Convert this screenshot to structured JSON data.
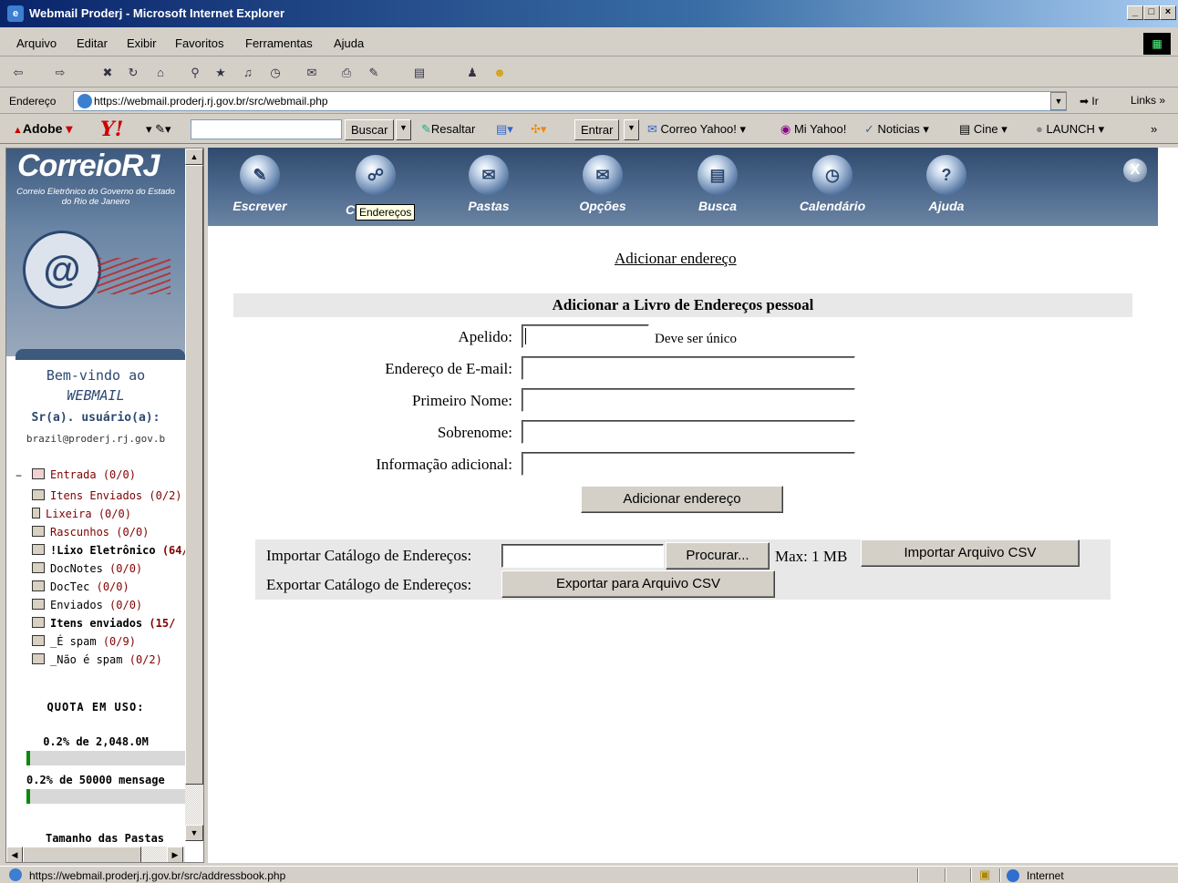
{
  "window": {
    "title": "Webmail Proderj - Microsoft Internet Explorer"
  },
  "menu": [
    "Arquivo",
    "Editar",
    "Exibir",
    "Favoritos",
    "Ferramentas",
    "Ajuda"
  ],
  "address": {
    "label": "Endereço",
    "url": "https://webmail.proderj.rj.gov.br/src/webmail.php",
    "go": "Ir",
    "links": "Links"
  },
  "yahoo_toolbar": {
    "adobe": "Adobe",
    "yahoo": "Y!",
    "search_button": "Buscar",
    "highlight": "Resaltar",
    "enter": "Entrar",
    "mail": "Correo Yahoo!",
    "my_yahoo": "Mi Yahoo!",
    "news": "Noticias",
    "cinema": "Cine",
    "launch": "LAUNCH"
  },
  "sidebar": {
    "logo": "CorreioRJ",
    "subtitle": "Correio Eletrônico do Governo do Estado do Rio de Janeiro",
    "welcome_line1": "Bem-vindo ao",
    "welcome_line2": "WEBMAIL",
    "user_label": "Sr(a). usuário(a):",
    "user_email": "brazil@proderj.rj.gov.b",
    "folders": [
      {
        "name": "Entrada",
        "count": "(0/0)"
      },
      {
        "name": "Itens Enviados",
        "count": "(0/2)"
      },
      {
        "name": "Lixeira",
        "count": "(0/0)"
      },
      {
        "name": "Rascunhos",
        "count": "(0/0)"
      },
      {
        "name": "!Lixo Eletrônico",
        "count": "(64/"
      },
      {
        "name": "DocNotes",
        "count": "(0/0)"
      },
      {
        "name": "DocTec",
        "count": "(0/0)"
      },
      {
        "name": "Enviados",
        "count": "(0/0)"
      },
      {
        "name": "Itens enviados",
        "count": "(15/"
      },
      {
        "name": "_É spam",
        "count": "(0/9)"
      },
      {
        "name": "_Não é spam",
        "count": "(0/2)"
      }
    ],
    "quota_title": "QUOTA EM USO:",
    "quota_size": "0.2% de 2,048.0M",
    "quota_size_fraction": 0.02,
    "quota_msgs": "0.2% de 50000 mensage",
    "quota_msgs_fraction": 0.02,
    "folder_sizes": "Tamanho das Pastas"
  },
  "nav": [
    {
      "label": "Escrever",
      "icon": "compose-icon"
    },
    {
      "label": "C",
      "icon": "addressbook-icon"
    },
    {
      "label": "Pastas",
      "icon": "folders-icon"
    },
    {
      "label": "Opções",
      "icon": "options-icon"
    },
    {
      "label": "Busca",
      "icon": "search-icon"
    },
    {
      "label": "Calendário",
      "icon": "calendar-icon"
    },
    {
      "label": "Ajuda",
      "icon": "help-icon"
    }
  ],
  "tooltip": "Endereços",
  "close": "X",
  "form": {
    "top_link": "Adicionar endereço",
    "header": "Adicionar a Livro de Endereços pessoal",
    "nickname_label": "Apelido:",
    "nickname_hint": "Deve ser único",
    "email_label": "Endereço de E-mail:",
    "firstname_label": "Primeiro Nome:",
    "lastname_label": "Sobrenome:",
    "info_label": "Informação adicional:",
    "submit": "Adicionar endereço"
  },
  "import": {
    "import_label": "Importar Catálogo de Endereços:",
    "browse": "Procurar...",
    "max": "Max: 1 MB",
    "import_button": "Importar Arquivo CSV",
    "export_label": "Exportar Catálogo de Endereços:",
    "export_button": "Exportar para Arquivo CSV"
  },
  "status": {
    "url": "https://webmail.proderj.rj.gov.br/src/addressbook.php",
    "zone": "Internet"
  }
}
